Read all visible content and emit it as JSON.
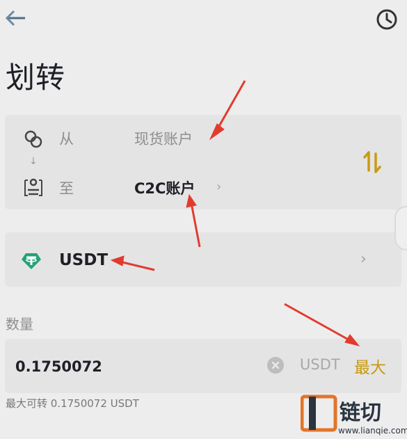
{
  "header": {
    "title": "划转"
  },
  "transfer": {
    "from_label": "从",
    "from_account": "现货账户",
    "to_label": "至",
    "to_account": "C2C账户",
    "arrow_glyph": "↓",
    "chevron_glyph": "›"
  },
  "coin": {
    "name": "USDT",
    "chevron_glyph": "›"
  },
  "amount": {
    "label": "数量",
    "value": "0.1750072",
    "unit": "USDT",
    "max_label": "最大"
  },
  "available": {
    "text": "最大可转  0.1750072 USDT"
  },
  "watermark": {
    "brand": "链切",
    "url": "www.lianqie.com"
  },
  "colors": {
    "background": "#ededed",
    "card": "#e4e4e4",
    "accent_gold": "#c99a12",
    "tether_green": "#26a17b",
    "annotation_red": "#e23b2e"
  },
  "icons": {
    "back": "back-arrow-icon",
    "history": "history-clock-icon",
    "from": "spot-wallet-icon",
    "to": "c2c-wallet-icon",
    "swap": "swap-arrows-icon",
    "coin": "tether-icon",
    "clear": "clear-circle-icon"
  }
}
